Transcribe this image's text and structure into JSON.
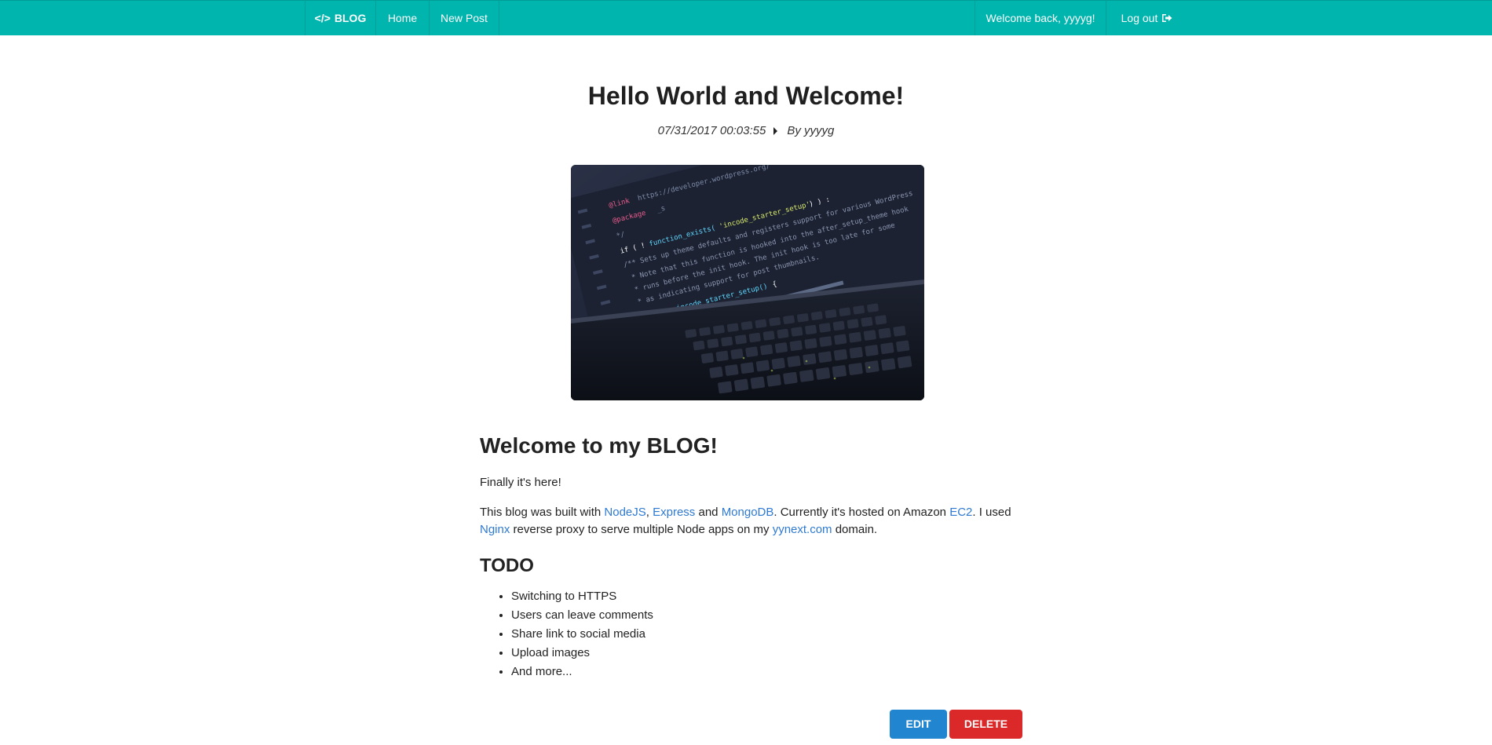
{
  "nav": {
    "brand_icon": "</>",
    "brand": "BLOG",
    "home": "Home",
    "new_post": "New Post",
    "welcome": "Welcome back, yyyyg!",
    "logout": "Log out",
    "logout_icon": "sign-out-icon",
    "bg_color": "#00b5ad"
  },
  "post": {
    "title": "Hello World and Welcome!",
    "date": "07/31/2017 00:03:55",
    "author": "By yyyyg",
    "image_label": "laptop-code-photo",
    "content": {
      "heading": "Welcome to my BLOG!",
      "intro": "Finally it's here!",
      "p2": {
        "t1": "This blog was built with ",
        "l1": "NodeJS",
        "t2": ", ",
        "l2": "Express",
        "t3": " and ",
        "l3": "MongoDB",
        "t4": ". Currently it's hosted on Amazon ",
        "l4": "EC2",
        "t5": ". I used ",
        "l5": "Nginx",
        "t6": " reverse proxy to serve multiple Node apps on my ",
        "l6": "yynext.com",
        "t7": " domain."
      },
      "todo_heading": "TODO",
      "todo": [
        "Switching to HTTPS",
        "Users can leave comments",
        "Share link to social media",
        "Upload images",
        "And more..."
      ]
    }
  },
  "buttons": {
    "edit": "EDIT",
    "delete": "DELETE",
    "edit_color": "#2185d0",
    "delete_color": "#db2828"
  },
  "colors": {
    "link": "#2f7ad1",
    "text": "#1f1f1f"
  }
}
